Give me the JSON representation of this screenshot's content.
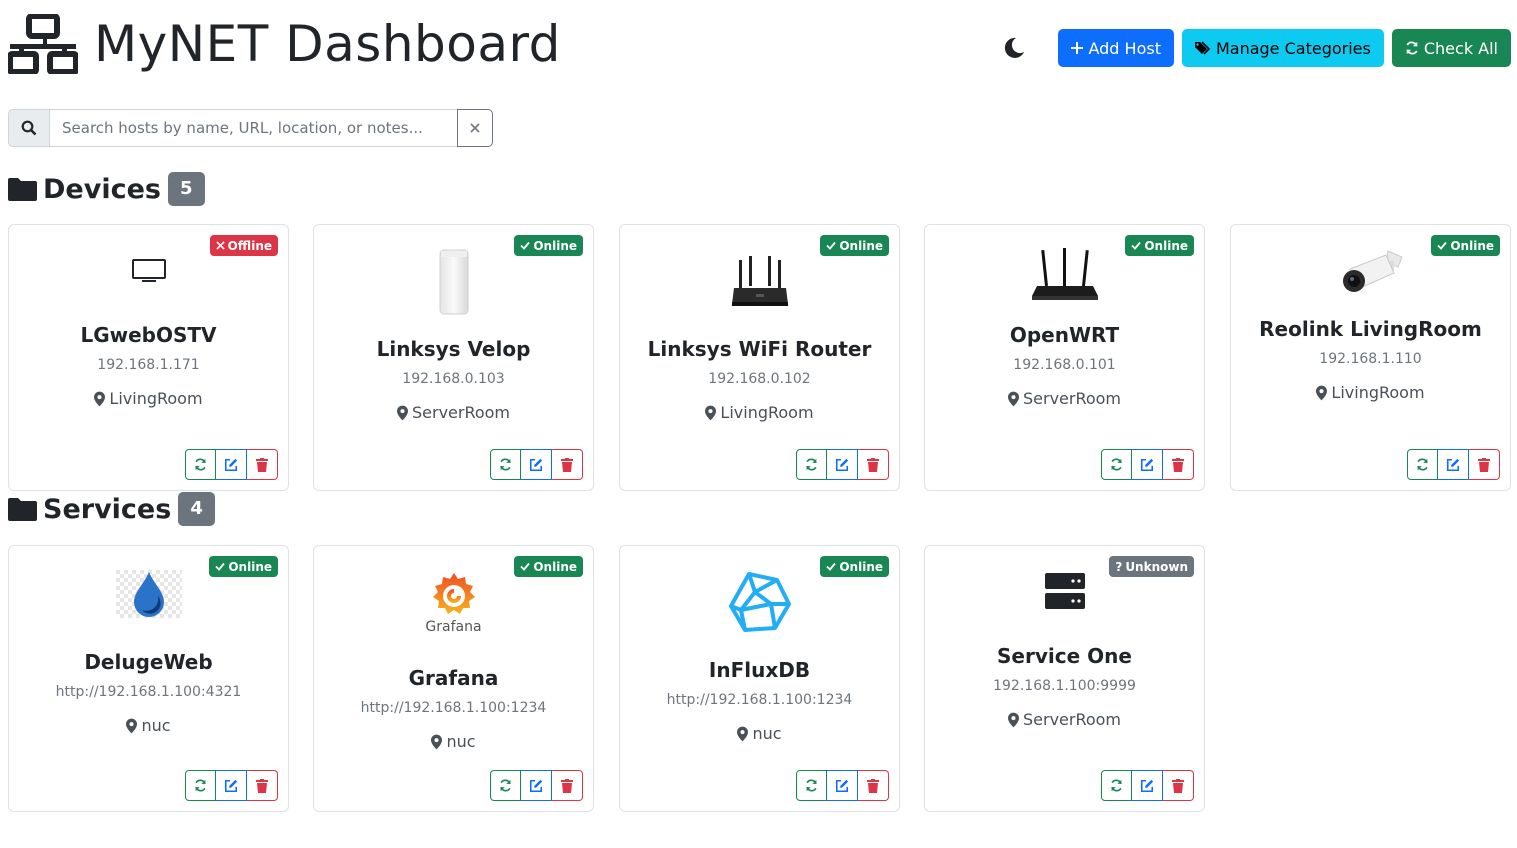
{
  "header": {
    "title": "MyNET Dashboard",
    "add_host": "Add Host",
    "manage_categories": "Manage Categories",
    "check_all": "Check All"
  },
  "search": {
    "placeholder": "Search hosts by name, URL, location, or notes...",
    "value": ""
  },
  "colors": {
    "primary": "#0d6efd",
    "info": "#0dcaf0",
    "success": "#198754",
    "danger": "#dc3545",
    "secondary": "#6c757d"
  },
  "categories": [
    {
      "name": "Devices",
      "count": "5",
      "hosts": [
        {
          "name": "LGwebOSTV",
          "address": "192.168.1.171",
          "location": "LivingRoom",
          "status": "Offline",
          "icon": "tv-icon"
        },
        {
          "name": "Linksys Velop",
          "address": "192.168.0.103",
          "location": "ServerRoom",
          "status": "Online",
          "icon": "mesh-node-icon"
        },
        {
          "name": "Linksys WiFi Router",
          "address": "192.168.0.102",
          "location": "LivingRoom",
          "status": "Online",
          "icon": "router-icon"
        },
        {
          "name": "OpenWRT",
          "address": "192.168.0.101",
          "location": "ServerRoom",
          "status": "Online",
          "icon": "router-icon"
        },
        {
          "name": "Reolink LivingRoom",
          "address": "192.168.1.110",
          "location": "LivingRoom",
          "status": "Online",
          "icon": "camera-icon"
        }
      ]
    },
    {
      "name": "Services",
      "count": "4",
      "hosts": [
        {
          "name": "DelugeWeb",
          "address": "http://192.168.1.100:4321",
          "location": "nuc",
          "status": "Online",
          "icon": "deluge-icon"
        },
        {
          "name": "Grafana",
          "address": "http://192.168.1.100:1234",
          "location": "nuc",
          "status": "Online",
          "icon": "grafana-icon",
          "icon_text": "Grafana"
        },
        {
          "name": "InFluxDB",
          "address": "http://192.168.1.100:1234",
          "location": "nuc",
          "status": "Online",
          "icon": "influxdb-icon"
        },
        {
          "name": "Service One",
          "address": "192.168.1.100:9999",
          "location": "ServerRoom",
          "status": "Unknown",
          "icon": "server-icon"
        }
      ]
    }
  ]
}
